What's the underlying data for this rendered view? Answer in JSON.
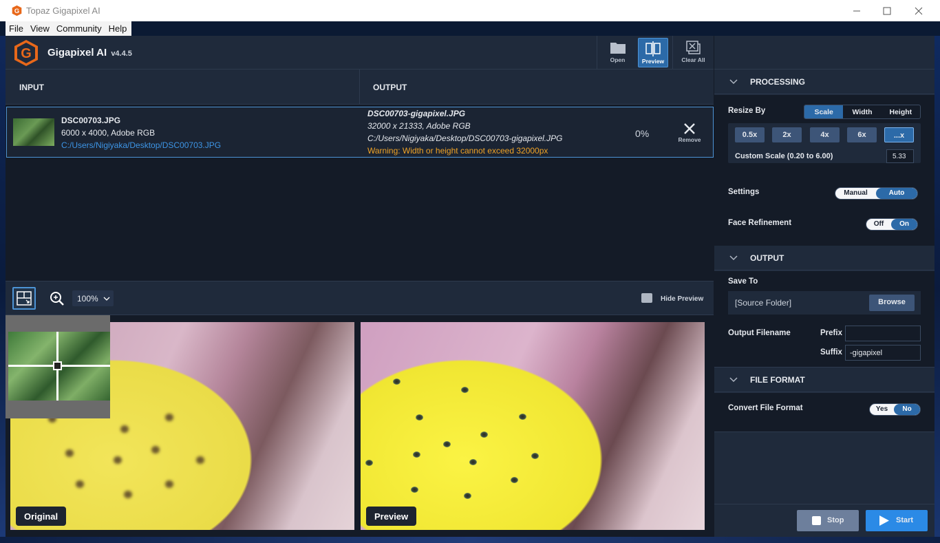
{
  "titlebar": {
    "title": "Topaz Gigapixel AI"
  },
  "menu": [
    "File",
    "View",
    "Community",
    "Help"
  ],
  "app": {
    "name": "Gigapixel AI",
    "version": "v4.4.5"
  },
  "toolbar": {
    "open": "Open",
    "preview": "Preview",
    "clear": "Clear All"
  },
  "columns": {
    "input": "INPUT",
    "output": "OUTPUT"
  },
  "file": {
    "name": "DSC00703.JPG",
    "info": "6000 x 4000, Adobe RGB",
    "path": "C:/Users/Nigiyaka/Desktop/DSC00703.JPG",
    "out_name": "DSC00703-gigapixel.JPG",
    "out_info": "32000 x 21333, Adobe RGB",
    "out_path": "C:/Users/Nigiyaka/Desktop/DSC00703-gigapixel.JPG",
    "warning": "Warning: Width or height cannot exceed 32000px",
    "progress": "0%",
    "remove": "Remove"
  },
  "preview_bar": {
    "zoom": "100%",
    "hide": "Hide Preview"
  },
  "panes": {
    "original": "Original",
    "preview": "Preview"
  },
  "processing": {
    "title": "PROCESSING",
    "resize_by": "Resize By",
    "resize_opts": [
      "Scale",
      "Width",
      "Height"
    ],
    "resize_selected": "Scale",
    "scales": [
      "0.5x",
      "2x",
      "4x",
      "6x",
      "...x"
    ],
    "scale_selected": "...x",
    "custom_label": "Custom Scale (0.20 to 6.00)",
    "custom_value": "5.33",
    "settings": "Settings",
    "settings_opts": [
      "Manual",
      "Auto"
    ],
    "settings_selected": "Auto",
    "face": "Face Refinement",
    "face_opts": [
      "Off",
      "On"
    ],
    "face_selected": "On"
  },
  "output": {
    "title": "OUTPUT",
    "save_to": "Save To",
    "folder": "[Source Folder]",
    "browse": "Browse",
    "filename": "Output Filename",
    "prefix": "Prefix",
    "prefix_value": "",
    "suffix": "Suffix",
    "suffix_value": "-gigapixel"
  },
  "format": {
    "title": "FILE FORMAT",
    "convert": "Convert File Format",
    "opts": [
      "Yes",
      "No"
    ],
    "selected": "No"
  },
  "actions": {
    "stop": "Stop",
    "start": "Start"
  },
  "colors": {
    "accent": "#2c6aa8",
    "panel": "#1f2a3b",
    "bg": "#141b27",
    "warning": "#f0a326",
    "link": "#3d95e6"
  }
}
